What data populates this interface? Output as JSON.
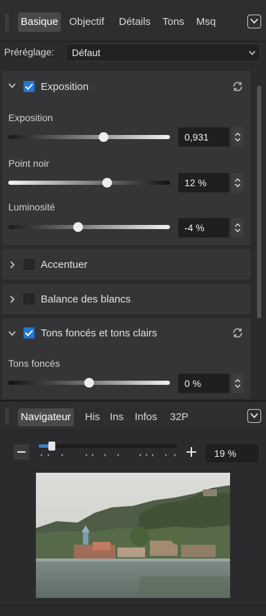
{
  "top_tabs": [
    {
      "label": "Basique",
      "active": true
    },
    {
      "label": "Objectif",
      "active": false
    },
    {
      "label": "Détails",
      "active": false
    },
    {
      "label": "Tons",
      "active": false
    },
    {
      "label": "Msq",
      "active": false
    }
  ],
  "preset": {
    "label": "Préréglage:",
    "value": "Défaut"
  },
  "sections": {
    "exposure": {
      "title": "Exposition",
      "checked": true,
      "controls": [
        {
          "label": "Exposition",
          "value": "0,931",
          "level": 0.59
        },
        {
          "label": "Point noir",
          "value": "12 %",
          "level": 0.61
        },
        {
          "label": "Luminosité",
          "value": "-4 %",
          "level": 0.43
        }
      ]
    },
    "sharpen": {
      "title": "Accentuer",
      "checked": false
    },
    "white_balance": {
      "title": "Balance des blancs",
      "checked": false
    },
    "shadows_highlights": {
      "title": "Tons foncés et tons clairs",
      "checked": true,
      "controls": [
        {
          "label": "Tons foncés",
          "value": "0 %",
          "level": 0.5
        }
      ]
    }
  },
  "nav_tabs": [
    {
      "label": "Navigateur",
      "active": true
    },
    {
      "label": "His",
      "active": false
    },
    {
      "label": "Ins",
      "active": false
    },
    {
      "label": "Infos",
      "active": false
    },
    {
      "label": "32P",
      "active": false
    }
  ],
  "navigator": {
    "zoom": "19 %",
    "zoom_level": 0.08
  },
  "colors": {
    "accent": "#1f78d1",
    "panel": "#353538",
    "background": "#2b2b2d"
  }
}
